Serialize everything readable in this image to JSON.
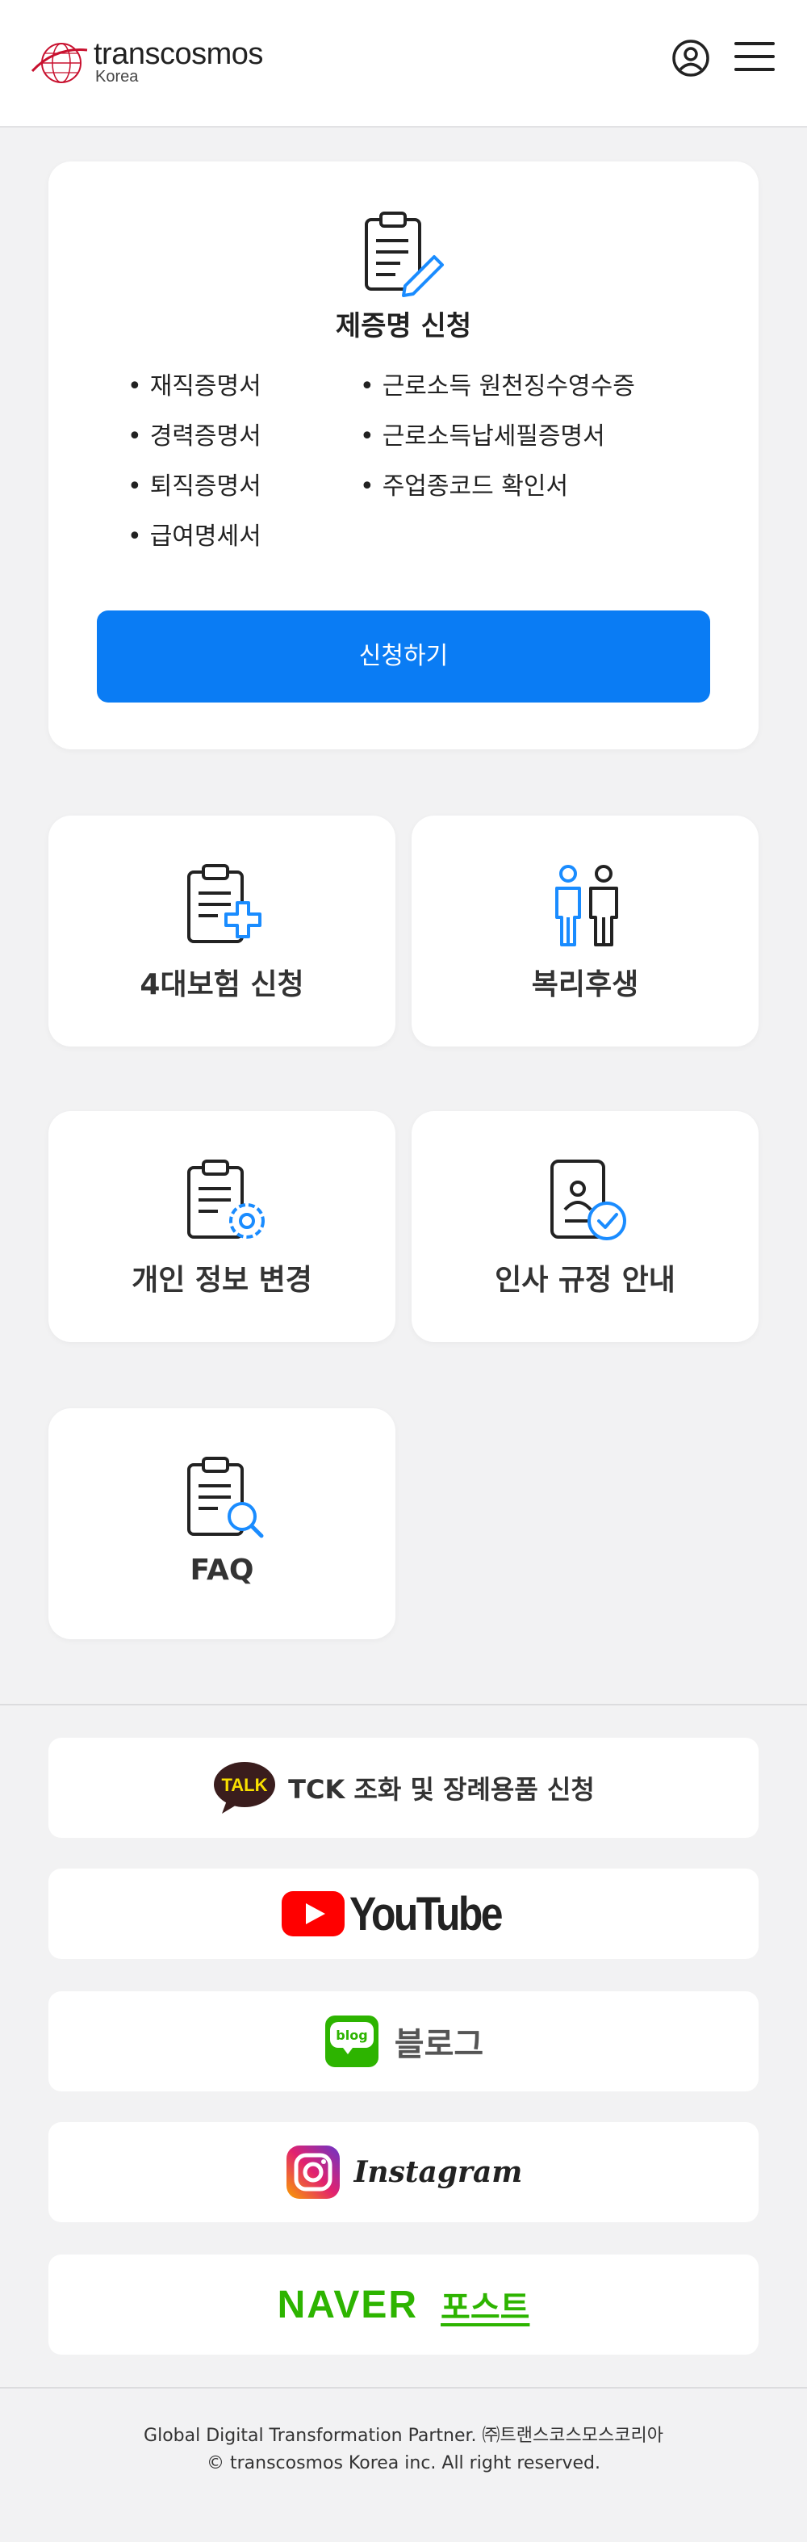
{
  "header": {
    "logo_text": "transcosmos",
    "logo_sub": "Korea"
  },
  "certificate": {
    "title": "제증명 신청",
    "left_items": [
      "재직증명서",
      "경력증명서",
      "퇴직증명서",
      "급여명세서"
    ],
    "right_items": [
      "근로소득 원천징수영수증",
      "근로소득납세필증명서",
      "주업종코드 확인서"
    ],
    "apply_label": "신청하기"
  },
  "tiles": {
    "insurance": "4대보험 신청",
    "welfare": "복리후생",
    "personal_info": "개인 정보 변경",
    "hr_rules": "인사 규정 안내",
    "faq": "FAQ"
  },
  "links": {
    "tck_badge": "TALK",
    "tck_label": "TCK 조화 및 장례용품 신청",
    "youtube_label": "YouTube",
    "blog_badge": "blog",
    "blog_label": "블로그",
    "instagram_label": "Instagram",
    "naver_label": "NAVER",
    "post_label": "포스트"
  },
  "footer": {
    "line1": "Global Digital Transformation Partner. ㈜트랜스코스모스코리아",
    "line2": "© transcosmos Korea inc. All right reserved."
  },
  "colors": {
    "primary": "#0a7cf4",
    "accent_icon": "#1a8cff",
    "youtube_red": "#ff0000",
    "naver_green": "#2db400",
    "kakao_yellow": "#f9e000"
  }
}
